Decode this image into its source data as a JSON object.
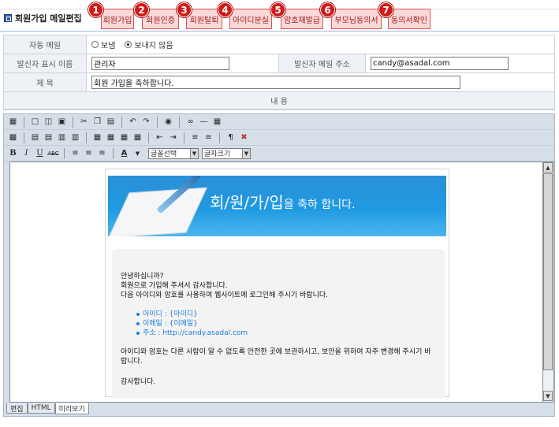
{
  "page": {
    "title": "회원가입 메일편집",
    "tabs": [
      {
        "num": "1",
        "label": "회원가입"
      },
      {
        "num": "2",
        "label": "회원인증"
      },
      {
        "num": "3",
        "label": "회원탈퇴"
      },
      {
        "num": "4",
        "label": "아이디분실"
      },
      {
        "num": "5",
        "label": "암호재발급"
      },
      {
        "num": "6",
        "label": "부모님동의서"
      },
      {
        "num": "7",
        "label": "동의서확인"
      }
    ]
  },
  "form": {
    "auto_mail_label": "자동 메일",
    "auto_mail_options": [
      "보냄",
      "보내지 않음"
    ],
    "auto_mail_selected": "보내지 않음",
    "sender_name_label": "발신자 표시 이름",
    "sender_name_value": "관리자",
    "sender_email_label": "발신자 메일 주소",
    "sender_email_value": "candy@asadal.com",
    "subject_label": "제 목",
    "subject_value": "회원 가입을 축하합니다.",
    "content_label": "내 용"
  },
  "editor": {
    "font_select": "글꼴선택",
    "size_select": "글자크기",
    "mode_tabs": [
      "편집",
      "HTML",
      "미리보기"
    ],
    "active_mode": "미리보기"
  },
  "preview": {
    "headline_main": "회/원/가/입",
    "headline_suffix": "을 축하 합니다.",
    "greeting": "안녕하십니까?",
    "line1": "회원으로 가입해 주셔서 감사합니다.",
    "line2": "다음 아이디와 암호를 사용하여 웹사이트에 로그인해 주시기 바랍니다.",
    "items": [
      "아이디 : {아이디}",
      "이메일 : {이메일}",
      "주소 : http://candy.asadal.com"
    ],
    "notice": "아이디와 암호는 다른 사람이 알 수 없도록 안전한 곳에 보관하시고, 보안을 위하여 자주 변경해 주시기 바랍니다.",
    "closing": "감사합니다."
  },
  "colors": {
    "tab_bg": "#fbd9d9",
    "tab_border": "#e35050",
    "badge_red": "#d11a1a",
    "banner_blue": "#1f9ae2",
    "link_blue": "#1d7ed8"
  }
}
